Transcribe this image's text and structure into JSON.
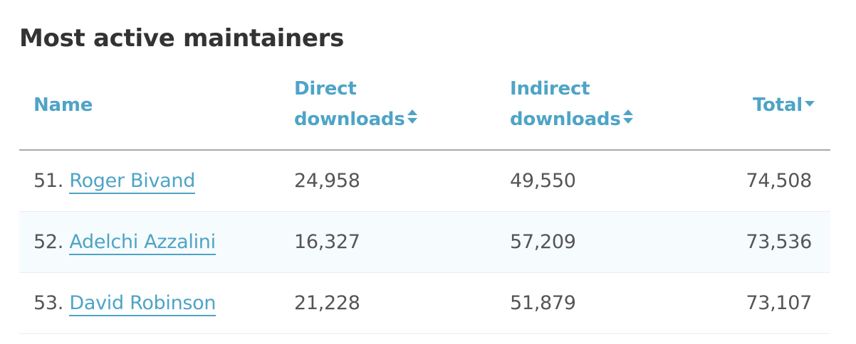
{
  "title": "Most active maintainers",
  "colors": {
    "accent": "#4ea4c6",
    "text": "#555555",
    "title": "#333333",
    "row_alt": "#f6fbfd",
    "header_rule": "#a9a9a9"
  },
  "columns": {
    "name": "Name",
    "direct_line1": "Direct",
    "direct_line2": "downloads",
    "indirect_line1": "Indirect",
    "indirect_line2": "downloads",
    "total": "Total"
  },
  "icons": {
    "direct_sort": "sort-both-icon",
    "indirect_sort": "sort-both-icon",
    "total_sort": "sort-descending-icon"
  },
  "rows": [
    {
      "rank": "51.",
      "name": "Roger Bivand",
      "direct": "24,958",
      "indirect": "49,550",
      "total": "74,508"
    },
    {
      "rank": "52.",
      "name": "Adelchi Azzalini",
      "direct": "16,327",
      "indirect": "57,209",
      "total": "73,536"
    },
    {
      "rank": "53.",
      "name": "David Robinson",
      "direct": "21,228",
      "indirect": "51,879",
      "total": "73,107"
    }
  ]
}
